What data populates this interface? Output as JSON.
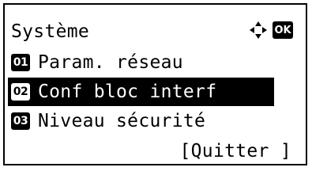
{
  "screen": {
    "title": "Système",
    "ok_label": "OK",
    "nav_icon": "dpad-arrows-icon",
    "menu_items": [
      {
        "number": "01",
        "label": "Param. réseau",
        "selected": false
      },
      {
        "number": "02",
        "label": "Conf bloc interf",
        "selected": true
      },
      {
        "number": "03",
        "label": "Niveau sécurité",
        "selected": false
      }
    ],
    "quit_label": "[Quitter ]"
  }
}
